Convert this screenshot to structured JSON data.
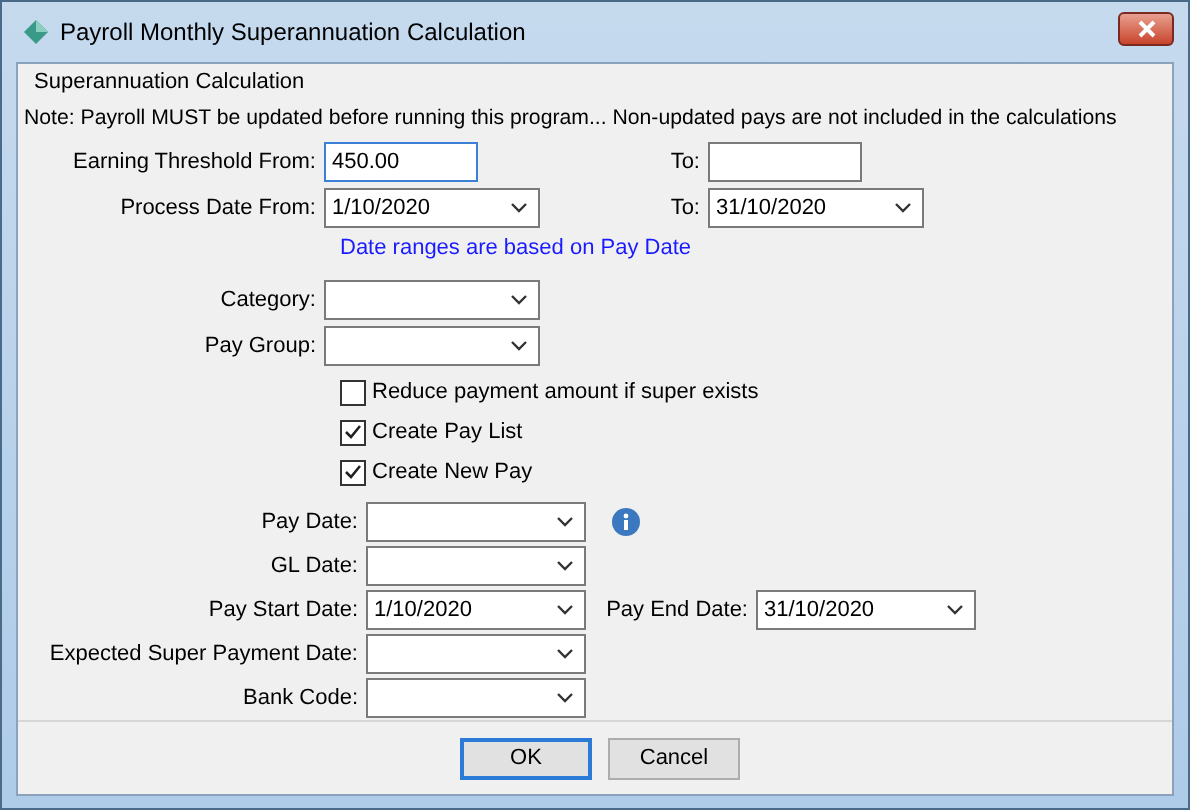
{
  "window": {
    "title": "Payroll Monthly Superannuation Calculation"
  },
  "group_title": "Superannuation Calculation",
  "note": "Note:  Payroll MUST be updated before running this program...  Non-updated pays are not included in the calculations",
  "range_rows": [
    {
      "label": "Earning Threshold From:",
      "from": {
        "kind": "text",
        "value": "450.00",
        "focused": true
      },
      "to_label": "To:",
      "to": {
        "kind": "text",
        "focused": false
      }
    },
    {
      "label": "Process Date From:",
      "from": {
        "kind": "dropdown",
        "value": "1/10/2020",
        "focused": false
      },
      "to_label": "To:",
      "to": {
        "kind": "dropdown",
        "value": "31/10/2020",
        "focused": false
      }
    }
  ],
  "hint": "Date ranges are based on Pay Date",
  "selectors": [
    {
      "label": "Category:"
    },
    {
      "label": "Pay Group:"
    }
  ],
  "checkboxes": [
    {
      "label": "Reduce payment amount if super exists",
      "checked": false
    },
    {
      "label": "Create Pay List",
      "checked": true
    },
    {
      "label": "Create New Pay",
      "checked": true
    }
  ],
  "date_fields": [
    {
      "label": "Pay Date:",
      "info": true
    },
    {
      "label": "GL Date:",
      "info": false
    },
    {
      "label": "Pay Start Date:",
      "value": "1/10/2020",
      "info": false,
      "extra": {
        "label": "Pay End Date:",
        "value": "31/10/2020"
      }
    },
    {
      "label": "Expected Super Payment Date:",
      "info": false
    },
    {
      "label": "Bank Code:",
      "info": false
    }
  ],
  "buttons": [
    {
      "label": "OK",
      "default": true
    },
    {
      "label": "Cancel",
      "default": false
    }
  ]
}
